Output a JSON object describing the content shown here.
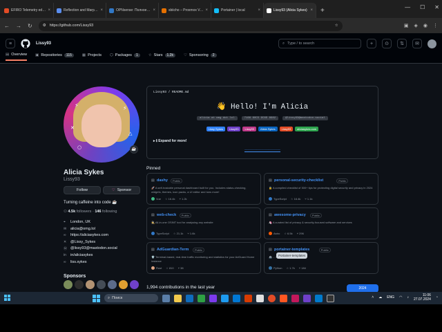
{
  "browser": {
    "tabs": [
      {
        "label": "EFIRO Telemetry edition – CF...",
        "color": "#e34c26"
      },
      {
        "label": "Reflection and Marpin NAT – ...",
        "color": "#5a8dee"
      },
      {
        "label": "OPNsense: Полное руководс...",
        "color": "#3178c6"
      },
      {
        "label": "sbiicho – Proxmox Virtual Envi...",
        "color": "#e57000"
      },
      {
        "label": "Portainer | local",
        "color": "#13bef9"
      },
      {
        "label": "Lissy93 (Alicia Sykes)",
        "color": "#ffffff"
      }
    ],
    "url": "https://github.com/Lissy93"
  },
  "github": {
    "search_placeholder": "Type / to search",
    "nav": [
      {
        "label": "Overview",
        "count": ""
      },
      {
        "label": "Repositories",
        "count": "115"
      },
      {
        "label": "Projects",
        "count": ""
      },
      {
        "label": "Packages",
        "count": "1"
      },
      {
        "label": "Stars",
        "count": "1.2k"
      },
      {
        "label": "Sponsoring",
        "count": "2"
      }
    ]
  },
  "profile": {
    "full_name": "Alicia Sykes",
    "login": "Lissy93",
    "follow_label": "Follow",
    "sponsor_label": "Sponsor",
    "bio": "Turning caffeine into code ☕",
    "followers_count": "4.5k",
    "followers_label": "followers",
    "following_count": "146",
    "following_label": "following",
    "details": [
      {
        "icon": "location-icon",
        "glyph": "⌖",
        "text": "London, UK"
      },
      {
        "icon": "mail-icon",
        "glyph": "✉",
        "text": "alicia@omg.lol"
      },
      {
        "icon": "link-icon",
        "glyph": "∞",
        "text": "https://aliciasykes.com"
      },
      {
        "icon": "twitter-icon",
        "glyph": "✕",
        "text": "@Lissy_Sykes"
      },
      {
        "icon": "mastodon-icon",
        "glyph": "Ⓜ",
        "text": "@lissy93@mastodon.social"
      },
      {
        "icon": "linkedin-icon",
        "glyph": "in",
        "text": "in/aliciasykes"
      },
      {
        "icon": "link-icon",
        "glyph": "∞",
        "text": "liss.sykes"
      }
    ],
    "sponsors_heading": "Sponsors"
  },
  "readme": {
    "path": "Lissy93 / README.md",
    "title": "👋 Hello! I'm Alicia",
    "codes": [
      "alicia at omg dot lol",
      "7166 60C5 9C8D 8982",
      "@lissy93@mastodon.social"
    ],
    "badges": [
      {
        "label": "Lissy Sykes",
        "color": "#2f81f7"
      },
      {
        "label": "Lissy93",
        "color": "#6e40c9"
      },
      {
        "label": "Lissy93",
        "color": "#bf3989"
      },
      {
        "label": "Alicia Sykes",
        "color": "#0a66c2"
      },
      {
        "label": "Lissy93",
        "color": "#e34c26"
      },
      {
        "label": "aliciasykes.com",
        "color": "#2da44e"
      }
    ],
    "expand_label": "▸ ℹ Expand for more!",
    "footer": "─────────────────────"
  },
  "pinned": {
    "heading": "Pinned",
    "public_label": "Public",
    "repos": [
      {
        "name": "dashy",
        "desc": "🚀 A self-hostable personal dashboard built for you. Includes status-checking, widgets, themes, icon packs, a UI editor and tons more!",
        "lang": "Vue",
        "lang_color": "#41b883",
        "stars": "16.4k",
        "forks": "1.2k"
      },
      {
        "name": "personal-security-checklist",
        "desc": "🔒 A compiled checklist of 300+ tips for protecting digital security and privacy in 2024",
        "lang": "TypeScript",
        "lang_color": "#3178c6",
        "stars": "16.4k",
        "forks": "1.1k"
      },
      {
        "name": "web-check",
        "desc": "🕵️ All-in-one OSINT tool for analysing any website",
        "lang": "TypeScript",
        "lang_color": "#3178c6",
        "stars": "21.1k",
        "forks": "1.6k"
      },
      {
        "name": "awesome-privacy",
        "desc": "🦄 A curated list of privacy & security-focused software and services",
        "lang": "Astro",
        "lang_color": "#ff5a03",
        "stars": "6.5k",
        "forks": "296"
      },
      {
        "name": "AdGuardian-Term",
        "desc": "🛡️ Terminal-based, real-time traffic monitoring and statistics for your AdGuard Home instance",
        "lang": "Rust",
        "lang_color": "#dea584",
        "stars": "810",
        "forks": "38"
      },
      {
        "name": "portainer-templates",
        "desc": "🚢 ... templates",
        "lang": "Python",
        "lang_color": "#3572A5",
        "stars": "1.7k",
        "forks": "184"
      }
    ],
    "tooltip": "Portainer-templates"
  },
  "contributions": {
    "text": "1,994 contributions in the last year",
    "year": "2024"
  },
  "taskbar": {
    "search": "Поиск",
    "lang": "ENG",
    "time": "11:06",
    "date": "27.07.2024"
  }
}
